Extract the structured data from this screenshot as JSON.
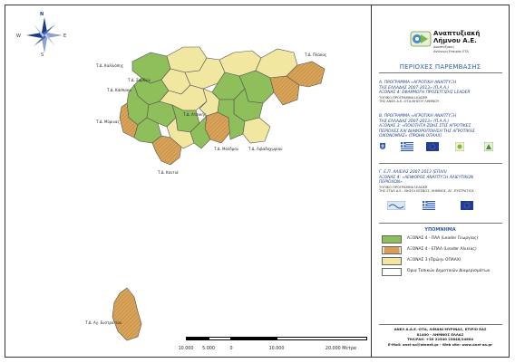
{
  "compass": {
    "n": "N",
    "s": "S",
    "e": "E",
    "w": "W"
  },
  "logo": {
    "title_line1": "Αναπτυξιακή",
    "title_line2": "Λήμνου Α.Ε.",
    "subtitle": "Αναπτυξιακή\nΑνώνυμη Εταιρία ΟΤΑ"
  },
  "heading": "ΠΕΡΙΟΧΕΣ ΠΑΡΕΜΒΑΣΗΣ",
  "programmes": [
    {
      "text": "Α. ΠΡΟΓΡΑΜΜΑ «ΑΓΡΟΤΙΚΗ ΑΝΑΠΤΥΞΗ\nΤΗΣ ΕΛΛΑΔΑΣ 2007-2013» (Π.Α.Α.)\nΑΞΟΝΑΣ 4: ΕΦΑΡΜΟΓΗ ΠΡΟΣΕΓΓΙΣΗΣ LEADER",
      "small": "ΤΟΠΙΚΟ ΠΡΟΓΡΑΜΜΑ LEADER\nΤΗΣ ΑΝΕΛ Α.Ε.-ΟΤΑ-ΝΗΣΟΥ ΛΗΜΝΟΥ"
    },
    {
      "text": "Β. ΠΡΟΓΡΑΜΜΑ «ΑΓΡΟΤΙΚΗ ΑΝΑΠΤΥΞΗ\nΤΗΣ ΕΛΛΑΔΑΣ 2007-2013» (Π.Α.Α.)\nΑΞΟΝΑΣ 3: «ΠΟΙΟΤΗΤΑ ΖΩΗΣ ΣΤΙΣ ΑΓΡΟΤΙΚΕΣ\nΠΕΡΙΟΧΕΣ ΚΑΙ ΔΙΑΦΟΡΟΠΟΙΗΣΗ ΤΗΣ ΑΓΡΟΤΙΚΗΣ\nΟΙΚΟΝΟΜΙΑΣ» (ΠΡΩΗΝ ΟΠΑΑΧ)",
      "small": ""
    },
    {
      "text": "Γ. Ε.Π. ΑΛΙΕΙΑΣ 2007-2013 (ΕΠΑΛ)\nΑΞΟΝΑΣ 4: «ΑΕΙΦΟΡΟΣ ΑΝΑΠΤΥΞΗ ΑΛΙΕΥΤΙΚΩΝ\nΠΕΡΙΟΧΩΝ»",
      "small": "ΤΟΠΙΚΟ ΠΡΟΓΡΑΜΜΑ LEADER\nΤΗΣ ΣΤΑΛ Α.Ε.: ΝΗΣΟΙ ΛΕΣΒΟΣ, ΛΗΜΝΟΣ, ΑΓ. ΕΥΣΤΡΑΤΙΟΣ"
    }
  ],
  "legend": {
    "title": "ΥΠΟΜΝΗΜΑ",
    "items": [
      {
        "label": "ΑΞΟΝΑΣ 4 - ΠΑΑ (Leader Γεωργίας)",
        "color": "#8fbf5a",
        "pattern": "none"
      },
      {
        "label": "ΑΞΟΝΑΣ 4 - ΕΠΑΛ (Leader Αλιείας)",
        "color": "#d9a45a",
        "pattern": "hatch"
      },
      {
        "label": "ΑΞΟΝΑΣ 3 (Πρώην ΟΠΑΑΧ)",
        "color": "#f2e7a0",
        "pattern": "none"
      },
      {
        "label": "Όρια Τοπικών Δημοτικών Διαμερισμάτων",
        "color": "#ffffff",
        "pattern": "none"
      }
    ]
  },
  "footer": {
    "line1": "ΑΝΕΛ Α.Α.Ε.-ΟΤΑ, ΛΙΜΑΝΙ ΜΥΡΙΝΑΣ, ΚΤΙΡΙΟ ΕΑΣ",
    "line2": "81400 - ΛΗΜΝΟΣ ΕΛΛΑΣ",
    "line3": "ΤΗΛ/FAX: +30 22540 23848/24604",
    "line4": "E-Mail: anel-aa@otenet.gr - Web site: www.anel-aa.gr"
  },
  "scale": {
    "labels": [
      "10.000",
      "5.000",
      "0",
      "10.000",
      "20.000 Μέτρα"
    ]
  },
  "map_labels": [
    "Τ.Δ. Καλλιόπης",
    "Τ.Δ. Κάσπακα",
    "Τ.Δ. Σαρδών",
    "Τ.Δ. Αγ. Ευστρατίου",
    "Τ.Δ. Μούδρου",
    "Τ.Δ. Μύρινας",
    "Τ.Δ. Ατσικής",
    "Τ.Δ. Κοντιά",
    "Τ.Δ. Λιβαδοχωρίου",
    "Τ.Δ. Πλάκας"
  ],
  "colors": {
    "green": "#8fbf5a",
    "orange": "#d9a45a",
    "yellow": "#f2e7a0",
    "heading_blue": "#2e5ea8"
  }
}
